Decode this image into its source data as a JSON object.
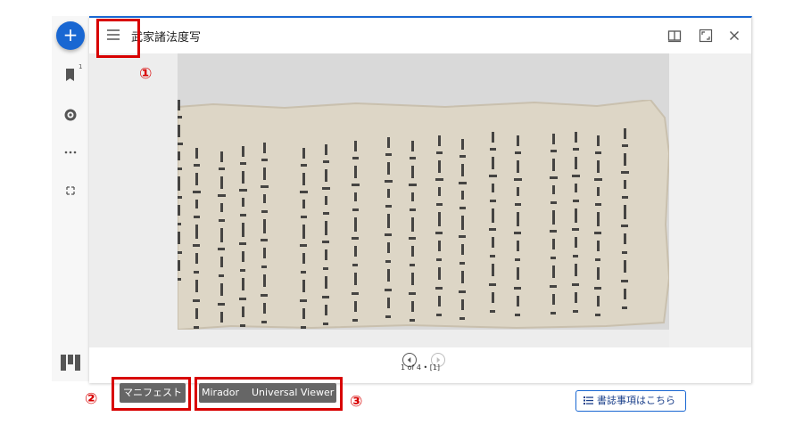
{
  "app": {
    "window_title": "武家諸法度写",
    "page_info": "1 of 4 • [1]",
    "bookmark_count": "1"
  },
  "buttons": {
    "manifest": "マニフェスト",
    "mirador": "Mirador",
    "universal_viewer": "Universal Viewer",
    "biblio": "書誌事項はこちら"
  },
  "annotations": {
    "marker_1": "①",
    "marker_2": "②",
    "marker_3": "③"
  },
  "icons": {
    "fab": "plus-icon",
    "rail": [
      "bookmark-icon",
      "gear-icon",
      "more-icon",
      "fullscreen-corners-icon"
    ],
    "window_toolbar": [
      "book-view-icon",
      "maximize-icon",
      "close-icon"
    ],
    "nav": [
      "previous-page-icon",
      "next-page-icon"
    ],
    "brand": "mirador-logo-icon"
  },
  "colors": {
    "accent": "#1967d2",
    "annotation_red": "#d80000",
    "dark_button": "#666666"
  }
}
